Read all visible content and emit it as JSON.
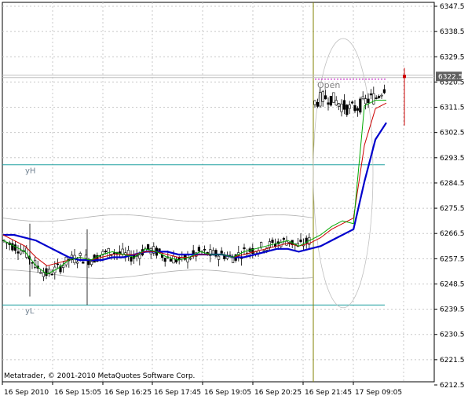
{
  "chart_data": {
    "type": "candlestick",
    "platform": "Metatrader",
    "copyright": "Metatrader, © 2001-2010 MetaQuotes Software Corp.",
    "y_axis_ticks": [
      "6347.5",
      "6338.5",
      "6329.5",
      "6320.5",
      "6311.5",
      "6302.5",
      "6293.5",
      "6284.5",
      "6275.5",
      "6266.5",
      "6257.5",
      "6248.5",
      "6239.5",
      "6230.5",
      "6221.5",
      "6212.5"
    ],
    "y_values": [
      6347.5,
      6338.5,
      6329.5,
      6320.5,
      6311.5,
      6302.5,
      6293.5,
      6284.5,
      6275.5,
      6266.5,
      6257.5,
      6248.5,
      6239.5,
      6230.5,
      6221.5,
      6212.5
    ],
    "ylim": [
      6212.5,
      6347.5
    ],
    "x_axis_ticks": [
      "16 Sep 2010",
      "16 Sep 15:05",
      "16 Sep 16:25",
      "16 Sep 17:45",
      "16 Sep 19:05",
      "16 Sep 20:25",
      "16 Sep 21:45",
      "17 Sep 09:05"
    ],
    "current_price": "6322.5",
    "current_price_value": 6322.5,
    "levels": [
      {
        "label": "yH",
        "value": 6291,
        "color": "#20a0a0"
      },
      {
        "label": "yL",
        "value": 6241,
        "color": "#20a0a0"
      }
    ],
    "open_label": "Open",
    "open_value": 6321.5,
    "session_separator_color": "#808000",
    "grid": true,
    "series": [
      {
        "color": "#0000cc",
        "values": [
          6266,
          6266,
          6265,
          6264,
          6262,
          6260,
          6258,
          6257,
          6257,
          6257,
          6258,
          6258,
          6259,
          6260,
          6260,
          6260,
          6259,
          6259,
          6259,
          6259,
          6259,
          6258,
          6258,
          6259,
          6260,
          6261,
          6261,
          6260,
          6261,
          6262,
          6264,
          6266,
          6268,
          6285,
          6300,
          6306
        ]
      },
      {
        "color": "#cc0000",
        "values": [
          6266,
          6264,
          6262,
          6258,
          6255,
          6256,
          6257,
          6258,
          6257,
          6258,
          6259,
          6259,
          6259,
          6260,
          6260,
          6259,
          6258,
          6258,
          6259,
          6259,
          6259,
          6258,
          6259,
          6260,
          6261,
          6262,
          6263,
          6262,
          6263,
          6265,
          6268,
          6270,
          6272,
          6298,
          6311,
          6313
        ]
      },
      {
        "color": "#00aa00",
        "values": [
          6264,
          6262,
          6260,
          6255,
          6252,
          6254,
          6257,
          6258,
          6257,
          6259,
          6260,
          6259,
          6258,
          6261,
          6260,
          6258,
          6257,
          6258,
          6260,
          6259,
          6259,
          6258,
          6260,
          6261,
          6262,
          6263,
          6264,
          6262,
          6264,
          6266,
          6269,
          6271,
          6270,
          6312,
          6314,
          6314
        ]
      }
    ]
  }
}
